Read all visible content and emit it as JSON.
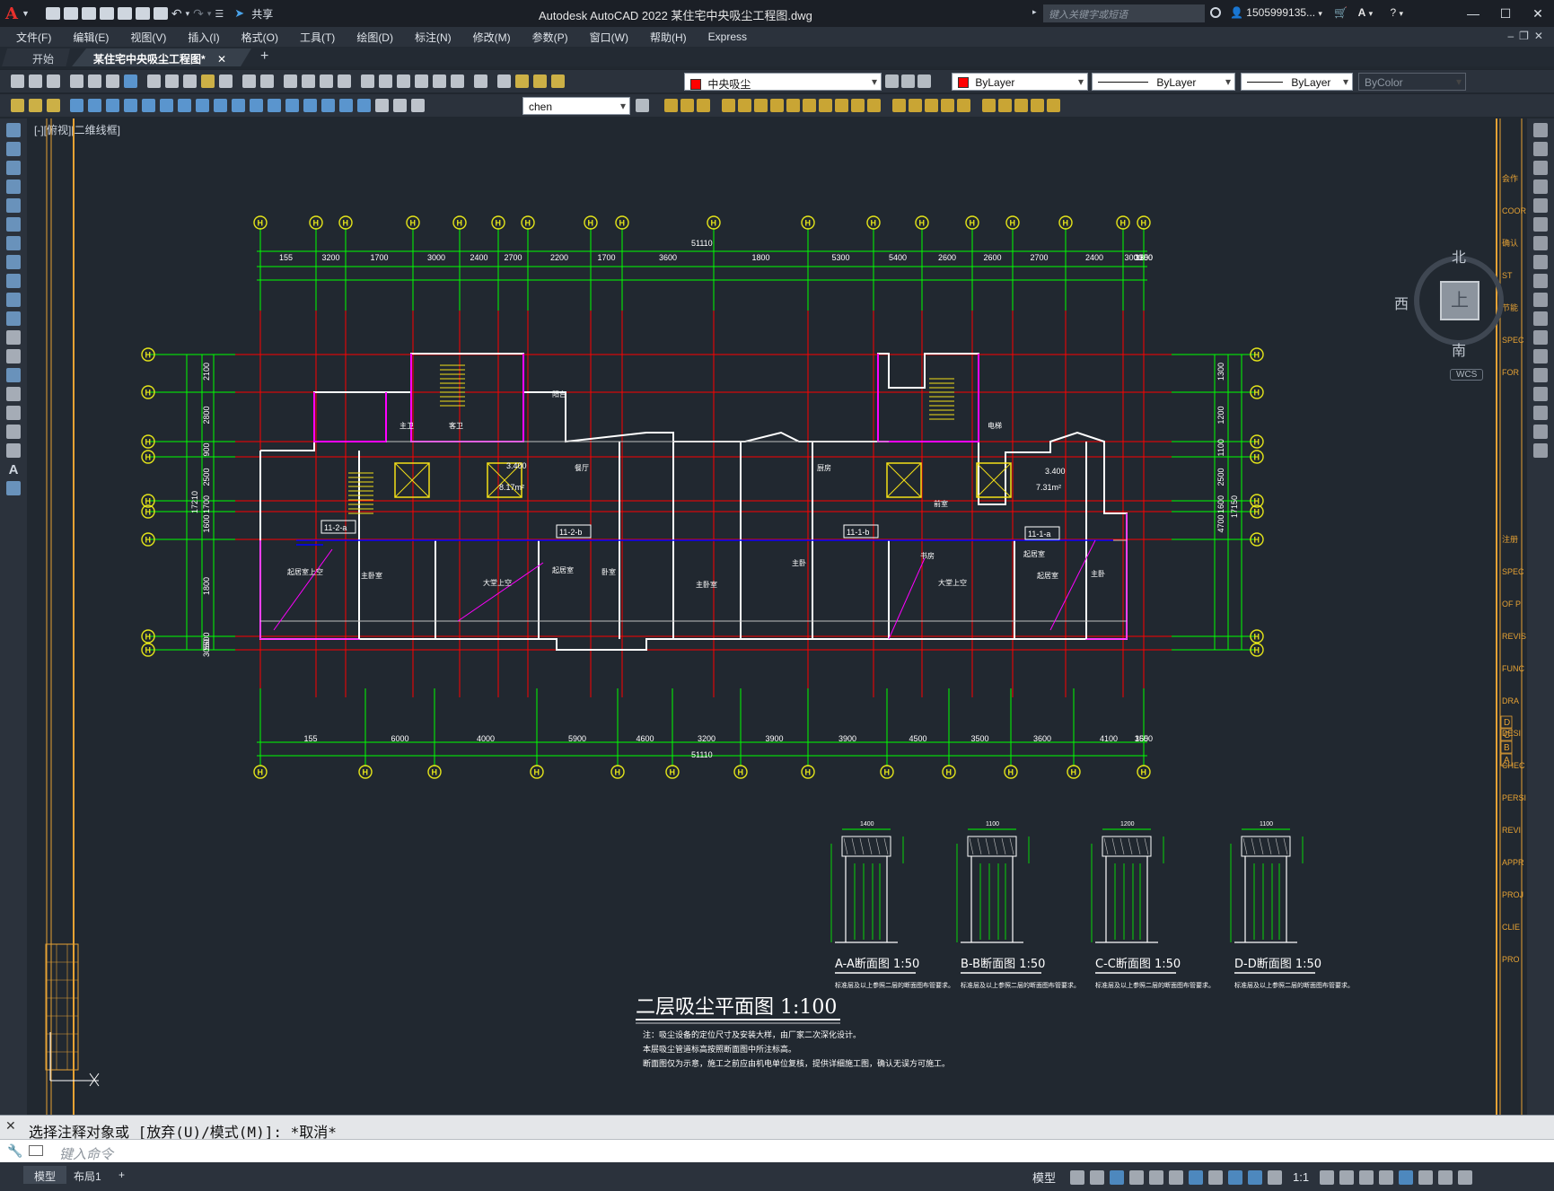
{
  "titlebar": {
    "app_logo": "A",
    "share": "共享",
    "title": "Autodesk AutoCAD 2022    某住宅中央吸尘工程图.dwg",
    "search_placeholder": "键入关键字或短语",
    "user": "1505999135...",
    "minimize_icon": "minimize-icon",
    "maximize_icon": "maximize-icon",
    "close_icon": "close-icon"
  },
  "menu": {
    "items": [
      "文件(F)",
      "编辑(E)",
      "视图(V)",
      "插入(I)",
      "格式(O)",
      "工具(T)",
      "绘图(D)",
      "标注(N)",
      "修改(M)",
      "参数(P)",
      "窗口(W)",
      "帮助(H)",
      "Express"
    ]
  },
  "tabs": {
    "start": "开始",
    "active": "某住宅中央吸尘工程图*",
    "add": "+"
  },
  "toolbar": {
    "layer_name": "中央吸尘",
    "layer_color": "#ff0000",
    "color_value": "ByLayer",
    "linetype_value": "ByLayer",
    "lineweight_value": "ByLayer",
    "plotstyle_value": "ByColor",
    "text_style": "chen"
  },
  "viewport": {
    "label": "[-][俯视][二维线框]",
    "compass": {
      "north": "北",
      "south": "南",
      "west": "西",
      "top": "上",
      "wcs": "WCS"
    }
  },
  "drawing": {
    "plan_title": "二层吸尘平面图 1:100",
    "notes": [
      "注：吸尘设备的定位尺寸及安装大样，由厂家二次深化设计。",
      "本层吸尘管道标高按照断面图中所注标高。",
      "断面图仅为示意，施工之前应由机电单位复核，提供详细施工图，确认无误方可施工。"
    ],
    "top_total": "51110",
    "bottom_total": "51110",
    "top_dims": [
      "155",
      "3200",
      "1700",
      "3000",
      "2400",
      "2700",
      "2200",
      "1700",
      "3600",
      "1800",
      "5300",
      "5400",
      "2600",
      "2600",
      "2700",
      "2400",
      "3000",
      "3300",
      "1200",
      "155"
    ],
    "bottom_dims": [
      "155",
      "6000",
      "4000",
      "5900",
      "4600",
      "3200",
      "3900",
      "3900",
      "4500",
      "3500",
      "3600",
      "4100",
      "3600",
      "155"
    ],
    "left_dims": [
      "2100",
      "2800",
      "900",
      "2500",
      "1700",
      "1600",
      "1800",
      "5500",
      "3050"
    ],
    "right_dims": [
      "1300",
      "1200",
      "1100",
      "2500",
      "1600",
      "4700"
    ],
    "left_total": "17210",
    "right_total": "17150",
    "area_labels": [
      "8.17m²",
      "7.31m²"
    ],
    "elevations": [
      "3.400",
      "3.400"
    ],
    "riser_labels": [
      "11-2-a",
      "11-2-b",
      "11-1-b",
      "11-1-a"
    ],
    "rooms": [
      "起居室上空",
      "主卧室",
      "大堂上空",
      "起居室",
      "卧室",
      "主卧室",
      "主卧",
      "书房",
      "起居室",
      "大堂上空",
      "起居室",
      "主卧",
      "餐厅",
      "厨房",
      "主卫",
      "客卫",
      "阳台",
      "电梯",
      "前室"
    ],
    "sections": [
      {
        "title": "A-A断面图 1:50",
        "width": "1400",
        "note": "标准层及以上参照二层的断面图布管要求。"
      },
      {
        "title": "B-B断面图 1:50",
        "width": "1100",
        "note": "标准层及以上参照二层的断面图布管要求。"
      },
      {
        "title": "C-C断面图 1:50",
        "width": "1200",
        "note": "标准层及以上参照二层的断面图布管要求。"
      },
      {
        "title": "D-D断面图 1:50",
        "width": "1100",
        "note": "标准层及以上参照二层的断面图布管要求。"
      }
    ],
    "titleblock_rows": [
      "D",
      "C",
      "B",
      "A"
    ],
    "titleblock_right": [
      "会作",
      "COOR",
      "确认",
      "ST",
      "节能",
      "SPEC",
      "FOR",
      "注册",
      "SPEC",
      "OF P",
      "REVIS",
      "FUNC",
      "DRA",
      "DESI",
      "CHEC",
      "PERSI",
      "REVI",
      "APPR",
      "PROJ",
      "CLIE",
      "PRO"
    ],
    "grid_axis_symbol": "H"
  },
  "command": {
    "history": "选择注释对象或 [放弃(U)/模式(M)]: *取消*",
    "placeholder": "键入命令"
  },
  "status": {
    "layout_tabs": [
      "模型",
      "布局1"
    ],
    "add_tab": "+",
    "model_label": "模型",
    "scale": "1:1"
  },
  "colors": {
    "canvas_bg": "#212830",
    "grid_green": "#00ff00",
    "axis_red": "#ff0000",
    "wall_magenta": "#ff00ff",
    "wall_white": "#ffffff",
    "detail_blue": "#0000ff",
    "frame_orange": "#e6a234"
  }
}
